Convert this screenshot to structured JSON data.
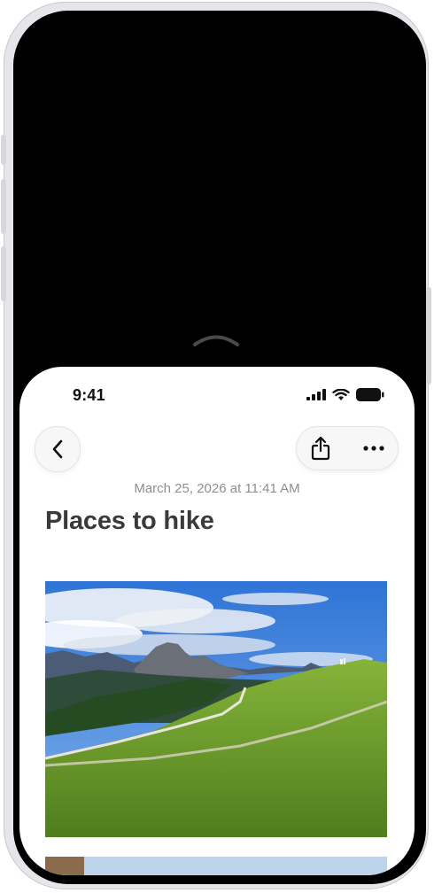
{
  "status_bar": {
    "time": "9:41",
    "icons": [
      "cellular-signal-icon",
      "wifi-icon",
      "battery-icon"
    ]
  },
  "navigation": {
    "back_icon": "chevron-left-icon",
    "share_icon": "share-icon",
    "more_icon": "ellipsis-icon"
  },
  "note": {
    "date": "March 25, 2026 at 11:41 AM",
    "title": "Places to hike"
  },
  "colors": {
    "accent_text": "#3a3a3c",
    "secondary_text": "#8e8e93",
    "sky": "#3d7fd8",
    "grass": "#6f9a2a"
  }
}
